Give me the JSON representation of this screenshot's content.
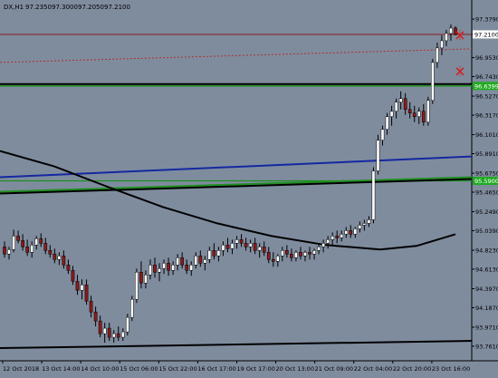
{
  "header": {
    "symbol": "DX,H1",
    "open": "97.2350",
    "high": "97.3000",
    "low": "97.2050",
    "close": "97.2100"
  },
  "colors": {
    "background": "#7f8c9e",
    "bull_candle": "#ffffff",
    "bear_candle": "#8b1a1a",
    "wick": "#000000",
    "red_level": "#8b1a1a",
    "green_level": "#1f8f1f",
    "blue_trend": "#1428a0",
    "black_line": "#000000",
    "price_tag_green": "#22aa22"
  },
  "price_axis": {
    "ticks": [
      "97.3790",
      "97.2100",
      "96.9530",
      "96.7430",
      "96.5270",
      "96.3170",
      "96.1010",
      "95.8910",
      "95.6750",
      "95.4650",
      "95.2490",
      "95.0390",
      "94.8230",
      "94.6130",
      "94.3970",
      "94.1870",
      "93.9710",
      "93.7610"
    ],
    "current_price": "97.2100",
    "green_level_upper": "96.6399",
    "green_level_lower": "95.5900"
  },
  "time_axis": {
    "labels": [
      "12 Oct 2018",
      "13 Oct 14:00",
      "14 Oct 10:00",
      "15 Oct 06:00",
      "15 Oct 22:00",
      "16 Oct 17:00",
      "19 Oct 17:00",
      "20 Oct 13:00",
      "21 Oct 09:00",
      "22 Oct 04:00",
      "22 Oct 20:00",
      "23 Oct 16:00"
    ]
  },
  "chart_data": {
    "type": "candlestick",
    "instrument": "DX",
    "timeframe": "H1",
    "ylim": [
      93.6,
      97.45
    ],
    "candles": [
      {
        "o": 94.86,
        "h": 94.92,
        "l": 94.74,
        "c": 94.78
      },
      {
        "o": 94.78,
        "h": 94.86,
        "l": 94.72,
        "c": 94.83
      },
      {
        "o": 94.83,
        "h": 95.05,
        "l": 94.8,
        "c": 94.98
      },
      {
        "o": 94.98,
        "h": 95.04,
        "l": 94.9,
        "c": 94.93
      },
      {
        "o": 94.93,
        "h": 95.0,
        "l": 94.82,
        "c": 94.86
      },
      {
        "o": 94.86,
        "h": 94.94,
        "l": 94.76,
        "c": 94.8
      },
      {
        "o": 94.8,
        "h": 94.92,
        "l": 94.74,
        "c": 94.88
      },
      {
        "o": 94.88,
        "h": 94.98,
        "l": 94.83,
        "c": 94.95
      },
      {
        "o": 94.95,
        "h": 95.01,
        "l": 94.86,
        "c": 94.9
      },
      {
        "o": 94.9,
        "h": 94.96,
        "l": 94.78,
        "c": 94.82
      },
      {
        "o": 94.82,
        "h": 94.88,
        "l": 94.74,
        "c": 94.78
      },
      {
        "o": 94.78,
        "h": 94.84,
        "l": 94.68,
        "c": 94.72
      },
      {
        "o": 94.72,
        "h": 94.8,
        "l": 94.66,
        "c": 94.76
      },
      {
        "o": 94.76,
        "h": 94.82,
        "l": 94.62,
        "c": 94.66
      },
      {
        "o": 94.66,
        "h": 94.72,
        "l": 94.56,
        "c": 94.6
      },
      {
        "o": 94.6,
        "h": 94.65,
        "l": 94.44,
        "c": 94.48
      },
      {
        "o": 94.48,
        "h": 94.55,
        "l": 94.33,
        "c": 94.38
      },
      {
        "o": 94.38,
        "h": 94.5,
        "l": 94.28,
        "c": 94.44
      },
      {
        "o": 94.44,
        "h": 94.5,
        "l": 94.22,
        "c": 94.26
      },
      {
        "o": 94.26,
        "h": 94.32,
        "l": 94.08,
        "c": 94.14
      },
      {
        "o": 94.14,
        "h": 94.2,
        "l": 93.98,
        "c": 94.04
      },
      {
        "o": 94.04,
        "h": 94.1,
        "l": 93.86,
        "c": 93.9
      },
      {
        "o": 93.9,
        "h": 94.02,
        "l": 93.8,
        "c": 93.96
      },
      {
        "o": 93.96,
        "h": 94.02,
        "l": 93.82,
        "c": 93.86
      },
      {
        "o": 93.86,
        "h": 93.94,
        "l": 93.8,
        "c": 93.9
      },
      {
        "o": 93.9,
        "h": 93.98,
        "l": 93.82,
        "c": 93.86
      },
      {
        "o": 93.86,
        "h": 93.96,
        "l": 93.82,
        "c": 93.92
      },
      {
        "o": 93.92,
        "h": 94.12,
        "l": 93.88,
        "c": 94.08
      },
      {
        "o": 94.08,
        "h": 94.32,
        "l": 94.04,
        "c": 94.28
      },
      {
        "o": 94.28,
        "h": 94.62,
        "l": 94.24,
        "c": 94.58
      },
      {
        "o": 94.58,
        "h": 94.7,
        "l": 94.4,
        "c": 94.46
      },
      {
        "o": 94.46,
        "h": 94.6,
        "l": 94.4,
        "c": 94.55
      },
      {
        "o": 94.55,
        "h": 94.72,
        "l": 94.5,
        "c": 94.66
      },
      {
        "o": 94.66,
        "h": 94.74,
        "l": 94.52,
        "c": 94.58
      },
      {
        "o": 94.58,
        "h": 94.68,
        "l": 94.48,
        "c": 94.62
      },
      {
        "o": 94.62,
        "h": 94.72,
        "l": 94.56,
        "c": 94.68
      },
      {
        "o": 94.68,
        "h": 94.74,
        "l": 94.54,
        "c": 94.6
      },
      {
        "o": 94.6,
        "h": 94.7,
        "l": 94.55,
        "c": 94.66
      },
      {
        "o": 94.66,
        "h": 94.78,
        "l": 94.6,
        "c": 94.74
      },
      {
        "o": 94.74,
        "h": 94.8,
        "l": 94.62,
        "c": 94.66
      },
      {
        "o": 94.66,
        "h": 94.72,
        "l": 94.56,
        "c": 94.6
      },
      {
        "o": 94.6,
        "h": 94.7,
        "l": 94.54,
        "c": 94.66
      },
      {
        "o": 94.66,
        "h": 94.8,
        "l": 94.62,
        "c": 94.76
      },
      {
        "o": 94.76,
        "h": 94.82,
        "l": 94.64,
        "c": 94.68
      },
      {
        "o": 94.68,
        "h": 94.76,
        "l": 94.6,
        "c": 94.72
      },
      {
        "o": 94.72,
        "h": 94.86,
        "l": 94.68,
        "c": 94.82
      },
      {
        "o": 94.82,
        "h": 94.9,
        "l": 94.72,
        "c": 94.76
      },
      {
        "o": 94.76,
        "h": 94.86,
        "l": 94.7,
        "c": 94.82
      },
      {
        "o": 94.82,
        "h": 94.92,
        "l": 94.76,
        "c": 94.88
      },
      {
        "o": 94.88,
        "h": 94.96,
        "l": 94.8,
        "c": 94.84
      },
      {
        "o": 94.84,
        "h": 94.94,
        "l": 94.78,
        "c": 94.9
      },
      {
        "o": 94.9,
        "h": 94.98,
        "l": 94.84,
        "c": 94.94
      },
      {
        "o": 94.94,
        "h": 95.0,
        "l": 94.86,
        "c": 94.9
      },
      {
        "o": 94.9,
        "h": 94.96,
        "l": 94.82,
        "c": 94.86
      },
      {
        "o": 94.86,
        "h": 94.94,
        "l": 94.8,
        "c": 94.9
      },
      {
        "o": 94.9,
        "h": 94.96,
        "l": 94.78,
        "c": 94.82
      },
      {
        "o": 94.82,
        "h": 94.9,
        "l": 94.74,
        "c": 94.86
      },
      {
        "o": 94.86,
        "h": 94.92,
        "l": 94.76,
        "c": 94.8
      },
      {
        "o": 94.8,
        "h": 94.86,
        "l": 94.68,
        "c": 94.72
      },
      {
        "o": 94.72,
        "h": 94.8,
        "l": 94.64,
        "c": 94.7
      },
      {
        "o": 94.7,
        "h": 94.78,
        "l": 94.64,
        "c": 94.76
      },
      {
        "o": 94.76,
        "h": 94.86,
        "l": 94.7,
        "c": 94.82
      },
      {
        "o": 94.82,
        "h": 94.88,
        "l": 94.74,
        "c": 94.78
      },
      {
        "o": 94.78,
        "h": 94.84,
        "l": 94.7,
        "c": 94.74
      },
      {
        "o": 94.74,
        "h": 94.82,
        "l": 94.7,
        "c": 94.8
      },
      {
        "o": 94.8,
        "h": 94.86,
        "l": 94.72,
        "c": 94.76
      },
      {
        "o": 94.76,
        "h": 94.82,
        "l": 94.7,
        "c": 94.8
      },
      {
        "o": 94.8,
        "h": 94.86,
        "l": 94.72,
        "c": 94.78
      },
      {
        "o": 94.78,
        "h": 94.84,
        "l": 94.72,
        "c": 94.82
      },
      {
        "o": 94.82,
        "h": 94.9,
        "l": 94.78,
        "c": 94.86
      },
      {
        "o": 94.86,
        "h": 94.94,
        "l": 94.8,
        "c": 94.9
      },
      {
        "o": 94.9,
        "h": 94.98,
        "l": 94.84,
        "c": 94.94
      },
      {
        "o": 94.94,
        "h": 95.02,
        "l": 94.88,
        "c": 94.98
      },
      {
        "o": 94.98,
        "h": 95.04,
        "l": 94.9,
        "c": 94.96
      },
      {
        "o": 94.96,
        "h": 95.04,
        "l": 94.92,
        "c": 95.0
      },
      {
        "o": 95.0,
        "h": 95.08,
        "l": 94.96,
        "c": 95.04
      },
      {
        "o": 95.04,
        "h": 95.1,
        "l": 94.96,
        "c": 95.0
      },
      {
        "o": 95.0,
        "h": 95.08,
        "l": 94.96,
        "c": 95.06
      },
      {
        "o": 95.06,
        "h": 95.14,
        "l": 95.02,
        "c": 95.1
      },
      {
        "o": 95.1,
        "h": 95.16,
        "l": 95.04,
        "c": 95.12
      },
      {
        "o": 95.12,
        "h": 95.2,
        "l": 95.08,
        "c": 95.16
      },
      {
        "o": 95.16,
        "h": 95.74,
        "l": 95.12,
        "c": 95.7
      },
      {
        "o": 95.7,
        "h": 96.1,
        "l": 95.66,
        "c": 96.04
      },
      {
        "o": 96.04,
        "h": 96.2,
        "l": 95.98,
        "c": 96.16
      },
      {
        "o": 96.16,
        "h": 96.34,
        "l": 96.1,
        "c": 96.3
      },
      {
        "o": 96.3,
        "h": 96.42,
        "l": 96.2,
        "c": 96.36
      },
      {
        "o": 96.36,
        "h": 96.5,
        "l": 96.28,
        "c": 96.46
      },
      {
        "o": 96.46,
        "h": 96.58,
        "l": 96.38,
        "c": 96.5
      },
      {
        "o": 96.5,
        "h": 96.56,
        "l": 96.32,
        "c": 96.38
      },
      {
        "o": 96.38,
        "h": 96.46,
        "l": 96.28,
        "c": 96.34
      },
      {
        "o": 96.34,
        "h": 96.42,
        "l": 96.24,
        "c": 96.3
      },
      {
        "o": 96.3,
        "h": 96.4,
        "l": 96.22,
        "c": 96.36
      },
      {
        "o": 96.36,
        "h": 96.44,
        "l": 96.2,
        "c": 96.24
      },
      {
        "o": 96.24,
        "h": 96.52,
        "l": 96.2,
        "c": 96.48
      },
      {
        "o": 96.48,
        "h": 96.94,
        "l": 96.44,
        "c": 96.9
      },
      {
        "o": 96.9,
        "h": 97.12,
        "l": 96.84,
        "c": 97.06
      },
      {
        "o": 97.06,
        "h": 97.2,
        "l": 96.98,
        "c": 97.14
      },
      {
        "o": 97.14,
        "h": 97.26,
        "l": 97.08,
        "c": 97.22
      },
      {
        "o": 97.22,
        "h": 97.32,
        "l": 97.14,
        "c": 97.28
      },
      {
        "o": 97.28,
        "h": 97.3,
        "l": 97.2,
        "c": 97.21
      }
    ],
    "levels": {
      "red_horizontal": 97.21,
      "green_upper": 96.6399,
      "green_lower": 95.59,
      "black_horizontal": 96.66
    }
  }
}
